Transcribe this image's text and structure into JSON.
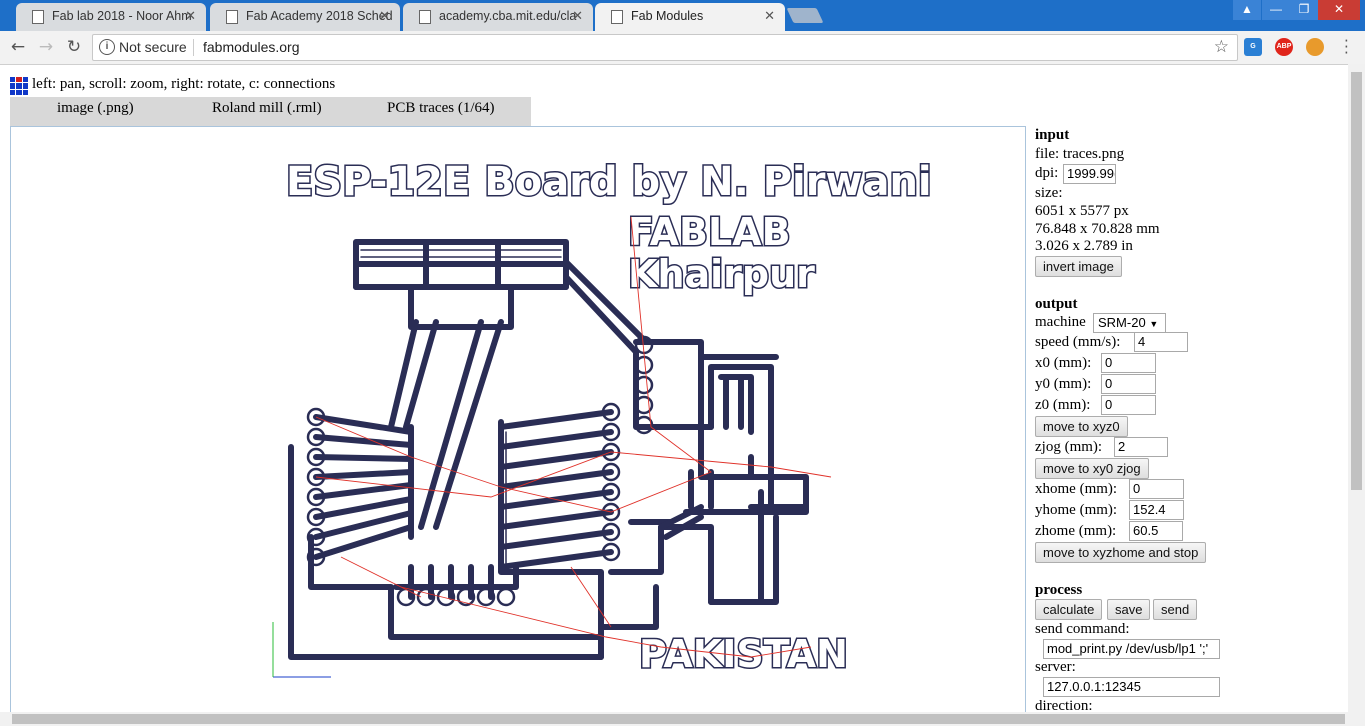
{
  "browser": {
    "tabs": [
      {
        "title": "Fab lab 2018 - Noor Ahm"
      },
      {
        "title": "Fab Academy 2018 Sched"
      },
      {
        "title": "academy.cba.mit.edu/cla"
      },
      {
        "title": "Fab Modules"
      }
    ],
    "security_label": "Not secure",
    "url": "fabmodules.org",
    "extensions": [
      "translate-icon",
      "adblock-icon",
      "cookie-icon"
    ]
  },
  "page": {
    "hint": "left: pan, scroll: zoom, right: rotate, c: connections",
    "view_tabs": [
      "image (.png)",
      "Roland mill (.rml)",
      "PCB traces (1/64)"
    ],
    "pcb_text": {
      "title": "ESP-12E Board by N. Pirwani",
      "org1": "FABLAB",
      "org2": "Khairpur",
      "country": "PAKISTAN"
    }
  },
  "panel": {
    "input": {
      "header": "input",
      "file": "file: traces.png",
      "dpi_label": "dpi:",
      "dpi_value": "1999.99(",
      "size_label": "size:",
      "size_px": "6051 x 5577 px",
      "size_mm": "76.848 x 70.828 mm",
      "size_in": "3.026 x 2.789 in",
      "invert_button": "invert image"
    },
    "output": {
      "header": "output",
      "machine_label": "machine",
      "machine_value": "SRM-20",
      "speed_label": "speed (mm/s):",
      "speed_value": "4",
      "x0_label": "x0 (mm):",
      "x0_value": "0",
      "y0_label": "y0 (mm):",
      "y0_value": "0",
      "z0_label": "z0 (mm):",
      "z0_value": "0",
      "move_xyz0": "move to xyz0",
      "zjog_label": "zjog (mm):",
      "zjog_value": "2",
      "move_xy0_zjog": "move to xy0 zjog",
      "xhome_label": "xhome (mm):",
      "xhome_value": "0",
      "yhome_label": "yhome (mm):",
      "yhome_value": "152.4",
      "zhome_label": "zhome (mm):",
      "zhome_value": "60.5",
      "move_home": "move to xyzhome and stop"
    },
    "process": {
      "header": "process",
      "calculate": "calculate",
      "save": "save",
      "send": "send",
      "send_command_label": "send command:",
      "send_command_value": "mod_print.py /dev/usb/lp1 ';'",
      "server_label": "server:",
      "server_value": "127.0.0.1:12345",
      "direction_label": "direction:"
    }
  }
}
